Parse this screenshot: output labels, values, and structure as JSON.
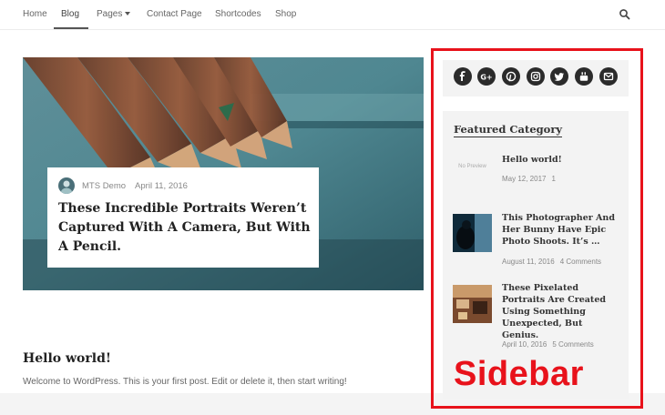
{
  "nav": {
    "items": [
      {
        "label": "Home"
      },
      {
        "label": "Blog"
      },
      {
        "label": "Pages"
      },
      {
        "label": "Contact Page"
      },
      {
        "label": "Shortcodes"
      },
      {
        "label": "Shop"
      }
    ],
    "active": "Blog"
  },
  "hero": {
    "author": "MTS Demo",
    "date": "April 11, 2016",
    "title": "These Incredible Portraits Weren’t Captured With A Camera, But With A Pencil."
  },
  "post": {
    "title": "Hello world!",
    "excerpt": "Welcome to WordPress. This is your first post. Edit or delete it, then start writing!"
  },
  "sidebar": {
    "social_icons": [
      "facebook-icon",
      "google-plus-icon",
      "pinterest-icon",
      "instagram-icon",
      "twitter-icon",
      "youtube-icon",
      "email-icon"
    ],
    "featured": {
      "heading": "Featured Category",
      "no_preview": "No Preview",
      "items": [
        {
          "title": "Hello world!",
          "date": "May 12, 2017",
          "comments": "1"
        },
        {
          "title": "This Photographer And Her Bunny Have Epic Photo Shoots. It’s …",
          "date": "August 11, 2016",
          "comments": "4 Comments"
        },
        {
          "title": "These Pixelated Portraits Are Created Using Something Unexpected, But Genius.",
          "date": "April 10, 2016",
          "comments": "5 Comments"
        }
      ]
    },
    "label": "Sidebar"
  },
  "colors": {
    "annotation_red": "#e8121b",
    "widget_bg": "#f3f3f3"
  }
}
